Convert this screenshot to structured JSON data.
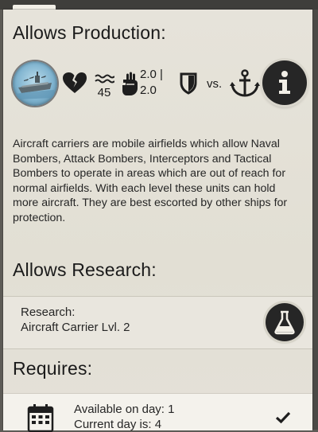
{
  "production": {
    "title": "Allows Production:",
    "unit": "aircraft-carrier-ship-icon",
    "stats": {
      "health": {
        "icon": "broken-heart-icon"
      },
      "speed": {
        "icon": "waves-icon",
        "value": "45"
      },
      "attack": {
        "icon": "fist-icon",
        "value_top": "2.0 |",
        "value_bottom": "2.0"
      },
      "defense": {
        "icon": "shield-icon",
        "vs_label": "vs.",
        "vs_target_icon": "anchor-icon"
      }
    },
    "description": "Aircraft carriers are mobile airfields which allow Naval Bombers, Attack Bombers, Interceptors and Tactical Bombers to operate in areas which are out of reach for normal airfields. With each level these units can hold more aircraft. They are best escorted by other ships for protection."
  },
  "research": {
    "title": "Allows Research:",
    "label": "Research:",
    "item": "Aircraft Carrier Lvl. 2"
  },
  "requires": {
    "title": "Requires:",
    "available": "Available on day: 1",
    "current": "Current day is: 4"
  },
  "colors": {
    "panel": "#e4e1d8",
    "dark_button": "#262626",
    "page_bg": "#5d5b56"
  }
}
